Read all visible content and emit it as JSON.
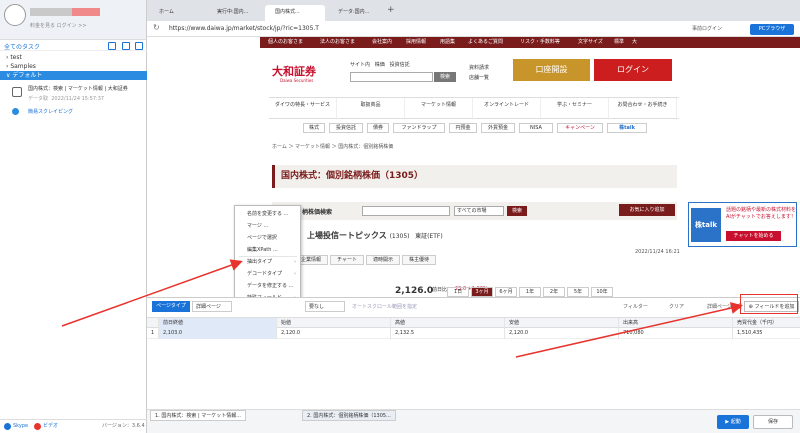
{
  "left_panel": {
    "username_hint": "料金を見る ログイン >>",
    "tasks_header": "全てのタスク",
    "tree": [
      {
        "label": "test"
      },
      {
        "label": "Samples"
      },
      {
        "label": "デフォルト"
      }
    ],
    "task_item": {
      "title": "国内株式：検索 | マーケット情報 | 大和証券",
      "status": "データ取",
      "timestamp": "2022/11/24 15:57:37",
      "sub": "簡易スクレイピング"
    },
    "bottom": {
      "skype": "Skype",
      "video": "ビデオ",
      "version": "バージョン：3.6.4"
    }
  },
  "browser": {
    "tabs": [
      {
        "label": "ホーム"
      },
      {
        "label": "実行中:国内..."
      },
      {
        "label": "国内株式..."
      },
      {
        "label": "データ:国内..."
      }
    ],
    "url": "https://www.daiwa.jp/market/stock/jp/?ric=1305.T",
    "right_label": "事前ログイン",
    "pc_browser": "PCブラウザ"
  },
  "site": {
    "topnav": [
      "個人のお客さま",
      "法人のお客さま",
      "会社案内",
      "採用情報",
      "用語集",
      "よくあるご質問",
      "リスク・手数料等",
      "文字サイズ",
      "標準",
      "大"
    ],
    "brand": "大和証券",
    "brand_sub": "Daiwa Securities",
    "search_opts": [
      "サイト内",
      "株価",
      "投資信託"
    ],
    "search_btn": "検索",
    "links": [
      "資料請求",
      "店舗一覧"
    ],
    "koza": "口座開設",
    "login": "ログイン",
    "mainnav": [
      "ダイワの特長・サービス",
      "取扱商品",
      "マーケット情報",
      "オンライントレード",
      "学ぶ・セミナー",
      "お問合わせ・お手続き"
    ],
    "subnav": [
      "株式",
      "投資信託",
      "債券",
      "ファンドラップ",
      "円預金",
      "外貨預金",
      "NISA",
      "キャンペーン",
      "株talk"
    ],
    "breadcrumb": "ホーム ＞ マーケット情報 ＞ 国内株式：個別銘柄株価",
    "page_title": "国内株式：個別銘柄株価（1305）",
    "ticker_label": "柄株価検索",
    "market_select": "すべての市場",
    "ticker_btn": "検索",
    "fav_btn": "お気に入り追加",
    "section_title": "上場投信ートピックス",
    "section_code": "(1305)",
    "section_market": "東証(ETF)",
    "section_date": "2022/11/24 16:21",
    "site_tabs": [
      "企業情報",
      "チャート",
      "適時開示",
      "株主優待"
    ],
    "price": "2,126.0",
    "prev_close_label": "前日比",
    "change": "23.0 +1.09%",
    "periods": [
      "1日",
      "3ヶ月",
      "6ヶ月",
      "1年",
      "2年",
      "5年",
      "10年"
    ],
    "ad": {
      "logo": "株talk",
      "text": "話題の銘柄や最新の株式材料をAIがチャットでお答えします！",
      "btn": "チャットを始める"
    }
  },
  "context_menu": {
    "items": [
      "名前を変更する ...",
      "マージ ...",
      "ページで選択",
      "編集XPath ...",
      "抽出タイプ",
      "デコードタイプ",
      "データを修正する ...",
      "特殊フィールド",
      "列を削除"
    ]
  },
  "data_panel": {
    "type_btn": "ページタイプ",
    "detail_page": "詳細ページ",
    "dropdown": "要なし",
    "autoscroll": "オートスクロール範囲を指定",
    "filter": "フィルター",
    "clear": "クリア",
    "detail_page2": "詳細ページ処理",
    "add_field": "フィールドを追加",
    "columns": [
      "前日終値",
      "始値",
      "高値",
      "安値",
      "出来高",
      "売買代金（千円）"
    ],
    "row": {
      "index": "1",
      "values": [
        "2,103.0",
        "2,120.0",
        "2,132.5",
        "2,120.0",
        "710,080",
        "1,510,435"
      ]
    }
  },
  "bottom_tabs": {
    "tabs": [
      "1. 国内株式：検索 | マーケット情報...",
      "2. 国内株式：個別銘柄株価（1305..."
    ],
    "run": "起動",
    "save": "保存"
  },
  "colors": {
    "accent": "#1a73d9",
    "brand": "#c8102e",
    "annotation": "#e8322d"
  }
}
